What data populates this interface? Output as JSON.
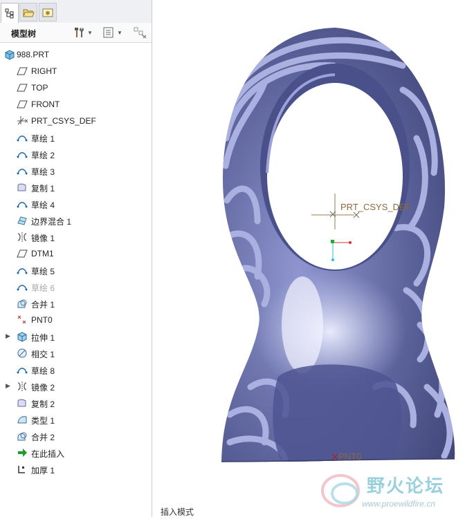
{
  "tabs": [
    {
      "name": "model-tree-tab",
      "icon": "tree-icon"
    },
    {
      "name": "folder-tab",
      "icon": "folder-icon"
    },
    {
      "name": "favorites-tab",
      "icon": "favorites-icon"
    }
  ],
  "toolbar": {
    "title": "模型树",
    "settings_icon": "hammer-wrench-icon",
    "show_icon": "list-icon",
    "filter_icon": "filter-icon"
  },
  "tree": {
    "root": {
      "label": "988.PRT",
      "icon": "part-icon"
    },
    "items": [
      {
        "label": "RIGHT",
        "icon": "datum-plane-icon",
        "expandable": false,
        "suppressed": false
      },
      {
        "label": "TOP",
        "icon": "datum-plane-icon",
        "expandable": false,
        "suppressed": false
      },
      {
        "label": "FRONT",
        "icon": "datum-plane-icon",
        "expandable": false,
        "suppressed": false
      },
      {
        "label": "PRT_CSYS_DEF",
        "icon": "csys-icon",
        "expandable": false,
        "suppressed": false
      },
      {
        "label": "草绘 1",
        "icon": "sketch-icon",
        "expandable": false,
        "suppressed": false
      },
      {
        "label": "草绘 2",
        "icon": "sketch-icon",
        "expandable": false,
        "suppressed": false
      },
      {
        "label": "草绘 3",
        "icon": "sketch-icon",
        "expandable": false,
        "suppressed": false
      },
      {
        "label": "复制 1",
        "icon": "copy-icon",
        "expandable": false,
        "suppressed": false
      },
      {
        "label": "草绘 4",
        "icon": "sketch-icon",
        "expandable": false,
        "suppressed": false
      },
      {
        "label": "边界混合 1",
        "icon": "boundary-blend-icon",
        "expandable": false,
        "suppressed": false
      },
      {
        "label": "镜像 1",
        "icon": "mirror-icon",
        "expandable": false,
        "suppressed": false
      },
      {
        "label": "DTM1",
        "icon": "datum-plane-icon",
        "expandable": false,
        "suppressed": false
      },
      {
        "label": "草绘 5",
        "icon": "sketch-icon",
        "expandable": false,
        "suppressed": false
      },
      {
        "label": "草绘 6",
        "icon": "sketch-icon",
        "expandable": false,
        "suppressed": true
      },
      {
        "label": "合并 1",
        "icon": "merge-icon",
        "expandable": false,
        "suppressed": false
      },
      {
        "label": "PNT0",
        "icon": "datum-point-icon",
        "expandable": false,
        "suppressed": false
      },
      {
        "label": "拉伸 1",
        "icon": "extrude-icon",
        "expandable": true,
        "suppressed": false
      },
      {
        "label": "相交 1",
        "icon": "intersect-icon",
        "expandable": false,
        "suppressed": false
      },
      {
        "label": "草绘 8",
        "icon": "sketch-icon",
        "expandable": false,
        "suppressed": false
      },
      {
        "label": "镜像 2",
        "icon": "mirror-icon",
        "expandable": true,
        "suppressed": false
      },
      {
        "label": "复制 2",
        "icon": "copy-icon",
        "expandable": false,
        "suppressed": false
      },
      {
        "label": "类型 1",
        "icon": "style-icon",
        "expandable": false,
        "suppressed": false
      },
      {
        "label": "合并 2",
        "icon": "merge-icon",
        "expandable": false,
        "suppressed": false
      },
      {
        "label": "在此插入",
        "icon": "insert-arrow-icon",
        "expandable": false,
        "suppressed": false
      },
      {
        "label": "加厚 1",
        "icon": "thicken-icon",
        "expandable": false,
        "suppressed": false
      }
    ]
  },
  "viewport": {
    "csys_label": "PRT_CSYS_DEF",
    "point_label": "PNT0",
    "model_color": "#5a6199",
    "stripe_color": "#aab0e0",
    "highlight_color": "#dde0f8"
  },
  "status": {
    "text": "插入模式"
  },
  "watermark": {
    "text": "野火论坛",
    "url": "www.proewildfire.cn"
  }
}
